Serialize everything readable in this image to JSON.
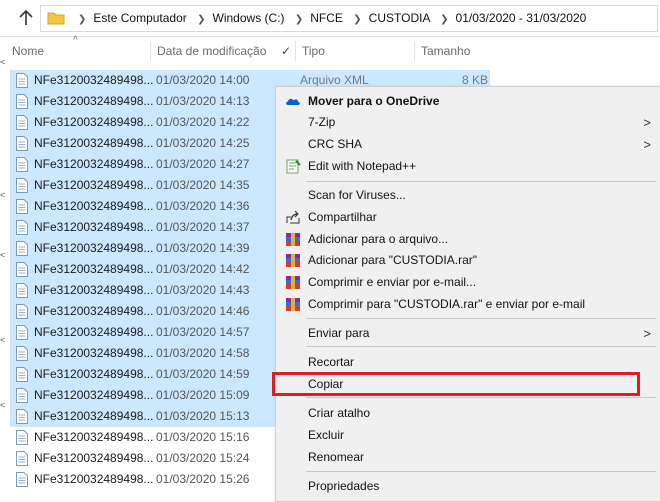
{
  "address_bar": {
    "breadcrumbs": [
      "Este Computador",
      "Windows (C:)",
      "NFCE",
      "CUSTODIA",
      "01/03/2020 - 31/03/2020"
    ]
  },
  "columns": {
    "name": "Nome",
    "date": "Data de modificação",
    "type": "Tipo",
    "size": "Tamanho"
  },
  "files": [
    {
      "name": "NFe3120032489498...",
      "date": "01/03/2020 14:00",
      "type": "Arquivo XML",
      "size": "8 KB",
      "selected": true
    },
    {
      "name": "NFe3120032489498...",
      "date": "01/03/2020 14:13",
      "type": "",
      "size": "",
      "selected": true
    },
    {
      "name": "NFe3120032489498...",
      "date": "01/03/2020 14:22",
      "type": "",
      "size": "",
      "selected": true
    },
    {
      "name": "NFe3120032489498...",
      "date": "01/03/2020 14:25",
      "type": "",
      "size": "",
      "selected": true
    },
    {
      "name": "NFe3120032489498...",
      "date": "01/03/2020 14:27",
      "type": "",
      "size": "",
      "selected": true
    },
    {
      "name": "NFe3120032489498...",
      "date": "01/03/2020 14:35",
      "type": "",
      "size": "",
      "selected": true
    },
    {
      "name": "NFe3120032489498...",
      "date": "01/03/2020 14:36",
      "type": "",
      "size": "",
      "selected": true
    },
    {
      "name": "NFe3120032489498...",
      "date": "01/03/2020 14:37",
      "type": "",
      "size": "",
      "selected": true
    },
    {
      "name": "NFe3120032489498...",
      "date": "01/03/2020 14:39",
      "type": "",
      "size": "",
      "selected": true
    },
    {
      "name": "NFe3120032489498...",
      "date": "01/03/2020 14:42",
      "type": "",
      "size": "",
      "selected": true
    },
    {
      "name": "NFe3120032489498...",
      "date": "01/03/2020 14:43",
      "type": "",
      "size": "",
      "selected": true
    },
    {
      "name": "NFe3120032489498...",
      "date": "01/03/2020 14:46",
      "type": "",
      "size": "",
      "selected": true
    },
    {
      "name": "NFe3120032489498...",
      "date": "01/03/2020 14:57",
      "type": "",
      "size": "",
      "selected": true
    },
    {
      "name": "NFe3120032489498...",
      "date": "01/03/2020 14:58",
      "type": "",
      "size": "",
      "selected": true
    },
    {
      "name": "NFe3120032489498...",
      "date": "01/03/2020 14:59",
      "type": "",
      "size": "",
      "selected": true
    },
    {
      "name": "NFe3120032489498...",
      "date": "01/03/2020 15:09",
      "type": "",
      "size": "",
      "selected": true
    },
    {
      "name": "NFe3120032489498...",
      "date": "01/03/2020 15:13",
      "type": "",
      "size": "",
      "selected": true
    },
    {
      "name": "NFe3120032489498...",
      "date": "01/03/2020 15:16",
      "type": "",
      "size": "",
      "selected": false
    },
    {
      "name": "NFe3120032489498...",
      "date": "01/03/2020 15:24",
      "type": "",
      "size": "",
      "selected": false
    },
    {
      "name": "NFe3120032489498...",
      "date": "01/03/2020 15:26",
      "type": "",
      "size": "",
      "selected": false
    }
  ],
  "context_menu": {
    "items": [
      {
        "label": "Mover para o OneDrive",
        "icon": "onedrive-cloud-icon",
        "bold": true,
        "submenu": false
      },
      {
        "label": "7-Zip",
        "icon": "",
        "bold": false,
        "submenu": true
      },
      {
        "label": "CRC SHA",
        "icon": "",
        "bold": false,
        "submenu": true
      },
      {
        "label": "Edit with Notepad++",
        "icon": "notepadpp-icon",
        "bold": false,
        "submenu": false
      },
      {
        "label": "Scan for Viruses...",
        "icon": "",
        "bold": false,
        "submenu": false
      },
      {
        "label": "Compartilhar",
        "icon": "share-icon",
        "bold": false,
        "submenu": false
      },
      {
        "label": "Adicionar para o arquivo...",
        "icon": "winrar-icon",
        "bold": false,
        "submenu": false
      },
      {
        "label": "Adicionar para \"CUSTODIA.rar\"",
        "icon": "winrar-icon",
        "bold": false,
        "submenu": false
      },
      {
        "label": "Comprimir e enviar por e-mail...",
        "icon": "winrar-icon",
        "bold": false,
        "submenu": false
      },
      {
        "label": "Comprimir para \"CUSTODIA.rar\" e enviar por e-mail",
        "icon": "winrar-icon",
        "bold": false,
        "submenu": false
      },
      {
        "label": "Enviar para",
        "icon": "",
        "bold": false,
        "submenu": true
      },
      {
        "label": "Recortar",
        "icon": "",
        "bold": false,
        "submenu": false
      },
      {
        "label": "Copiar",
        "icon": "",
        "bold": false,
        "submenu": false
      },
      {
        "label": "Criar atalho",
        "icon": "",
        "bold": false,
        "submenu": false
      },
      {
        "label": "Excluir",
        "icon": "",
        "bold": false,
        "submenu": false
      },
      {
        "label": "Renomear",
        "icon": "",
        "bold": false,
        "submenu": false
      },
      {
        "label": "Propriedades",
        "icon": "",
        "bold": false,
        "submenu": false
      }
    ],
    "highlighted_item": "Copiar",
    "highlight_color": "#e01b22"
  },
  "colors": {
    "selection": "#cce8ff",
    "menu_background": "#f0f0f0"
  }
}
